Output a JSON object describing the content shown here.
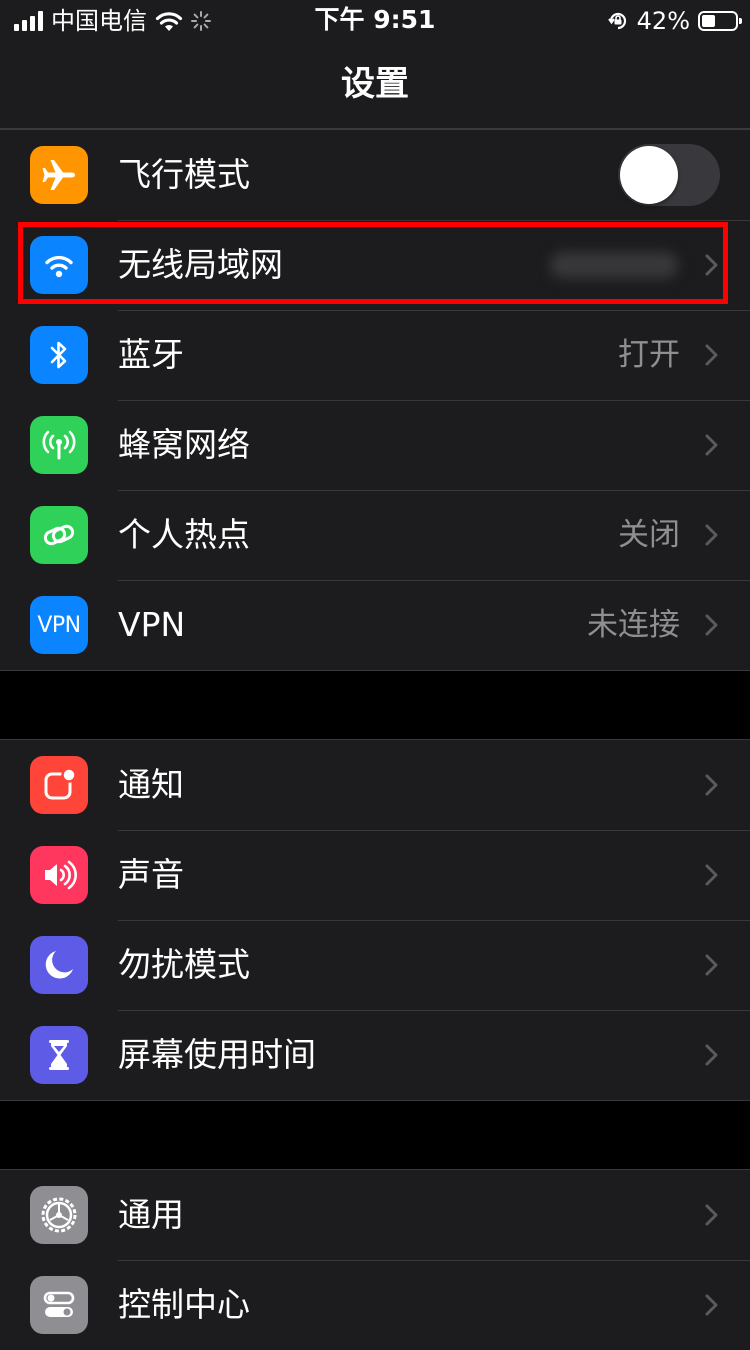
{
  "status_bar": {
    "carrier": "中国电信",
    "time": "下午 9:51",
    "battery_percent": "42%",
    "battery_level": 0.42
  },
  "nav": {
    "title": "设置"
  },
  "groups": [
    {
      "rows": [
        {
          "label": "飞行模式",
          "icon": "airplane-icon",
          "icon_color": "#ff9500",
          "toggle": false
        },
        {
          "label": "无线局域网",
          "icon": "wifi-icon",
          "icon_color": "#0a84ff",
          "value": ""
        },
        {
          "label": "蓝牙",
          "icon": "bluetooth-icon",
          "icon_color": "#0a84ff",
          "value": "打开"
        },
        {
          "label": "蜂窝网络",
          "icon": "cellular-icon",
          "icon_color": "#30d158",
          "value": ""
        },
        {
          "label": "个人热点",
          "icon": "hotspot-icon",
          "icon_color": "#30d158",
          "value": "关闭"
        },
        {
          "label": "VPN",
          "icon": "vpn-icon",
          "icon_text": "VPN",
          "icon_color": "#0a84ff",
          "value": "未连接"
        }
      ]
    },
    {
      "rows": [
        {
          "label": "通知",
          "icon": "notification-icon",
          "icon_color": "#ff453a"
        },
        {
          "label": "声音",
          "icon": "speaker-icon",
          "icon_color": "#ff375f"
        },
        {
          "label": "勿扰模式",
          "icon": "moon-icon",
          "icon_color": "#5e5ce6"
        },
        {
          "label": "屏幕使用时间",
          "icon": "hourglass-icon",
          "icon_color": "#5e5ce6"
        }
      ]
    },
    {
      "rows": [
        {
          "label": "通用",
          "icon": "gear-icon",
          "icon_color": "#8e8e93"
        },
        {
          "label": "控制中心",
          "icon": "control-center-icon",
          "icon_color": "#8e8e93"
        }
      ]
    }
  ],
  "highlight_color": "#ff0000"
}
